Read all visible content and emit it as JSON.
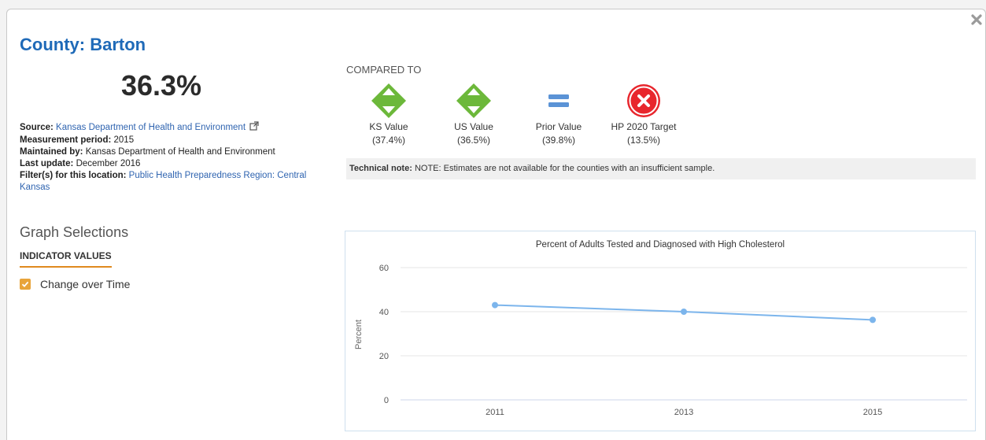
{
  "modal": {
    "title": "County: Barton",
    "big_value": "36.3%",
    "close_icon": "close-x-icon"
  },
  "meta": {
    "source_label": "Source:",
    "source_value": "Kansas Department of Health and Environment",
    "period_label": "Measurement period:",
    "period_value": "2015",
    "maintained_label": "Maintained by:",
    "maintained_value": "Kansas Department of Health and Environment",
    "update_label": "Last update:",
    "update_value": "December 2016",
    "filter_label": "Filter(s) for this location:",
    "filter_value": "Public Health Preparedness Region: Central Kansas"
  },
  "graph_selections": {
    "heading": "Graph Selections",
    "tab": "INDICATOR VALUES",
    "checkbox_label": "Change over Time",
    "checked": true
  },
  "compared": {
    "heading": "COMPARED TO",
    "items": [
      {
        "label": "KS Value",
        "value": "(37.4%)",
        "icon": "green-diamond-arrows-icon"
      },
      {
        "label": "US Value",
        "value": "(36.5%)",
        "icon": "green-diamond-arrows-icon"
      },
      {
        "label": "Prior Value",
        "value": "(39.8%)",
        "icon": "equals-icon"
      },
      {
        "label": "HP 2020 Target",
        "value": "(13.5%)",
        "icon": "red-x-circle-icon"
      }
    ]
  },
  "technical_note": {
    "label": "Technical note:",
    "text": "NOTE: Estimates are not available for the counties with an insufficient sample."
  },
  "colors": {
    "title": "#1f6ab8",
    "green": "#6cb83a",
    "blue_equals": "#5b93d6",
    "red": "#e8262d",
    "orange": "#e8a43a",
    "series": "#7cb5ec"
  },
  "chart_data": {
    "type": "line",
    "title": "Percent of Adults Tested and Diagnosed with High Cholesterol",
    "xlabel": "",
    "ylabel": "Percent",
    "categories": [
      "2011",
      "2013",
      "2015"
    ],
    "series": [
      {
        "values": [
          43,
          40,
          36.3
        ]
      }
    ],
    "ylim": [
      0,
      60
    ],
    "yticks": [
      0,
      20,
      40,
      60
    ],
    "grid": true,
    "legend": "none"
  }
}
